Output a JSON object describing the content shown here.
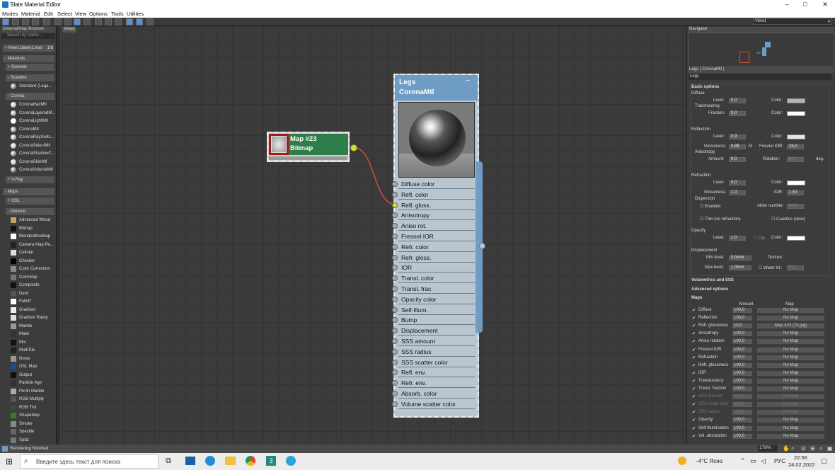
{
  "window": {
    "title": "Slate Material Editor"
  },
  "menu": [
    "Modes",
    "Material",
    "Edit",
    "Select",
    "View",
    "Options",
    "Tools",
    "Utilities"
  ],
  "browser": {
    "title": "Material/Map Browser",
    "search_placeholder": "Search by Name ...",
    "library": "+ New Library1.mat",
    "library_count": "1/8",
    "groups": {
      "materials": "- Materials",
      "general": "+ General",
      "scanline": "- Scanline",
      "standard": "Standard (Lega...",
      "corona": "- Corona",
      "vray": "+ V-Ray",
      "maps": "- Maps",
      "osl": "+ OSL",
      "maps_general": "- General"
    },
    "corona_items": [
      "CoronaHairMtl",
      "CoronaLayeredM...",
      "CoronaLightMtl",
      "CoronaMtl",
      "CoronaRaySwitc...",
      "CoronaSelectMtl",
      "CoronaShadowC...",
      "CoronaSkinMtl",
      "CoronaVolumeMtl"
    ],
    "map_items": [
      "Advanced Wood",
      "Bitmap",
      "BlendedBoxMap",
      "Camera Map Pe...",
      "Cellular",
      "Checker",
      "Color Correction",
      "ColorMap",
      "Composite",
      "Dent",
      "Falloff",
      "Gradient",
      "Gradient Ramp",
      "Marble",
      "Mask",
      "Mix",
      "MultiTile",
      "Noise",
      "OSL Map",
      "Output",
      "Particle Age",
      "Perlin Marble",
      "RGB Multiply",
      "RGB Tint",
      "ShapeMap",
      "Smoke",
      "Speckle",
      "Splat"
    ]
  },
  "view": {
    "tab": "View1",
    "dropdown": "View1"
  },
  "bitmap_node": {
    "name": "Map #23",
    "type": "Bitmap"
  },
  "mtl_node": {
    "name": "Legs",
    "type": "CoronaMtl",
    "slots": [
      "Diffuse color",
      "Refl. color",
      "Refl. gloss.",
      "Anisotropy",
      "Aniso rot.",
      "Fresnel IOR",
      "Refr. color",
      "Refr. gloss.",
      "IOR",
      "Transl. color",
      "Transl. frac.",
      "Opacity color",
      "Self-Illum.",
      "Bump",
      "Displacement",
      "SSS amount",
      "SSS radius",
      "SSS scatter color",
      "Refl. env.",
      "Refr. env.",
      "Absorb. color",
      "Volume scatter color"
    ]
  },
  "navigator": {
    "title": "Navigator"
  },
  "params": {
    "header": "Legs ( CoronaMtl )",
    "name": "Legs",
    "basic": "Basic options",
    "diffuse": "Diffuse",
    "level": "Level:",
    "color": "Color:",
    "translucency": "Translucency",
    "fraction": "Fraction:",
    "reflection": "Reflection",
    "glossiness": "Glossiness:",
    "fresnel": "Fresnel IOR:",
    "anisotropy": "Anisotropy",
    "amount": "Amount:",
    "rotation": "Rotation:",
    "deg": "deg.",
    "refraction": "Refraction",
    "ior": "IOR:",
    "dispersion": "Dispersion",
    "enabled": "Enabled",
    "abbe": "Abbe number:",
    "thin": "Thin (no refraction)",
    "caustics": "Caustics (slow)",
    "opacity": "Opacity",
    "clip": "Clip",
    "displacement": "Displacement",
    "min_level": "Min level:",
    "max_level": "Max level:",
    "texture": "Texture:",
    "water": "Water lvl.:",
    "m": "M",
    "values": {
      "diffuse_level": "0,0",
      "fraction": "0,0",
      "refl_level": "0,9",
      "refl_gloss": "0,85",
      "fresnel": "25,0",
      "aniso_amount": "0,0",
      "aniso_rot": "0,0",
      "refr_level": "0,0",
      "refr_gloss": "1,0",
      "ior": "1,52",
      "abbe": "40,0",
      "opacity_level": "1,0",
      "disp_min": "0,0mm",
      "disp_max": "1,0mm",
      "water": "0,0"
    },
    "volumetrics": "Volumetrics and SSS",
    "advanced": "Advanced options",
    "maps": "Maps",
    "col_amount": "Amount",
    "col_map": "Map",
    "map_rows": [
      {
        "name": "Diffuse",
        "amount": "100,0",
        "map": "No Map",
        "dim": false
      },
      {
        "name": "Reflection",
        "amount": "100,0",
        "map": "No Map",
        "dim": false
      },
      {
        "name": "Refl. glossiness",
        "amount": "10,0",
        "map": "Map #23 (74.jpg)",
        "dim": false
      },
      {
        "name": "Anisotropy",
        "amount": "100,0",
        "map": "No Map",
        "dim": false
      },
      {
        "name": "Aniso rotation",
        "amount": "100,0",
        "map": "No Map",
        "dim": false
      },
      {
        "name": "Fresnel IOR",
        "amount": "100,0",
        "map": "No Map",
        "dim": false
      },
      {
        "name": "Refraction",
        "amount": "100,0",
        "map": "No Map",
        "dim": false
      },
      {
        "name": "Refr. glossiness",
        "amount": "100,0",
        "map": "No Map",
        "dim": false
      },
      {
        "name": "IOR",
        "amount": "100,0",
        "map": "No Map",
        "dim": false
      },
      {
        "name": "Translucency",
        "amount": "100,0",
        "map": "No Map",
        "dim": false
      },
      {
        "name": "Transl. fraction",
        "amount": "100,0",
        "map": "No Map",
        "dim": false
      },
      {
        "name": "SSS amount",
        "amount": "100,0",
        "map": "No Map",
        "dim": true
      },
      {
        "name": "SSS scatt. color",
        "amount": "100,0",
        "map": "No Map",
        "dim": true
      },
      {
        "name": "SSS radius",
        "amount": "100,0",
        "map": "No Map",
        "dim": true
      },
      {
        "name": "Opacity",
        "amount": "100,0",
        "map": "No Map",
        "dim": false
      },
      {
        "name": "Self-Illumination",
        "amount": "100,0",
        "map": "No Map",
        "dim": false
      },
      {
        "name": "Vol. absorption",
        "amount": "100,0",
        "map": "No Map",
        "dim": false
      }
    ]
  },
  "status": {
    "text": "Rendering finished",
    "zoom": "178%"
  },
  "taskbar": {
    "search": "Введите здесь текст для поиска",
    "weather": "-4°C Ясно",
    "lang": "РУС",
    "time": "22:56",
    "date": "24.02.2022"
  },
  "colors": {
    "accent": "#5b8fd0",
    "node_header": "#6f9cc4",
    "bitmap_header": "#2e7d4a",
    "bitmap_bar": "#a01c1c",
    "wire": "#e04b3a",
    "port_active": "#d8e020"
  }
}
